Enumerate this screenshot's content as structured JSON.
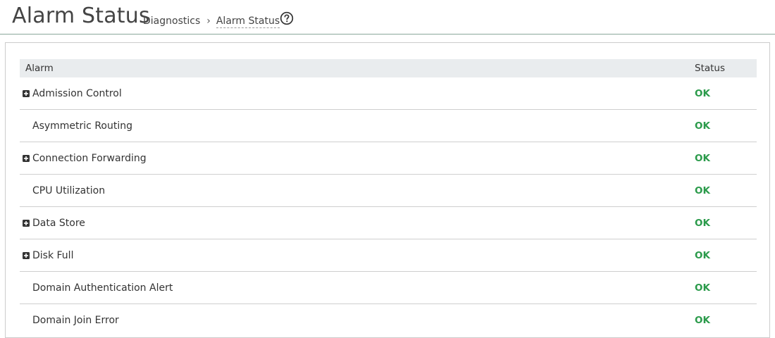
{
  "header": {
    "title": "Alarm Status",
    "breadcrumb": {
      "parent": "Diagnostics",
      "separator": "›",
      "current": "Alarm Status"
    },
    "help_icon": "question-circle-icon"
  },
  "table": {
    "columns": {
      "alarm": "Alarm",
      "status": "Status"
    },
    "rows": [
      {
        "name": "Admission Control",
        "status": "OK",
        "expandable": true
      },
      {
        "name": "Asymmetric Routing",
        "status": "OK",
        "expandable": false
      },
      {
        "name": "Connection Forwarding",
        "status": "OK",
        "expandable": true
      },
      {
        "name": "CPU Utilization",
        "status": "OK",
        "expandable": false
      },
      {
        "name": "Data Store",
        "status": "OK",
        "expandable": true
      },
      {
        "name": "Disk Full",
        "status": "OK",
        "expandable": true
      },
      {
        "name": "Domain Authentication Alert",
        "status": "OK",
        "expandable": false
      },
      {
        "name": "Domain Join Error",
        "status": "OK",
        "expandable": false
      }
    ]
  },
  "colors": {
    "status_ok": "#2a9a4a",
    "header_rule": "#8aa79a",
    "table_header_bg": "#e9ecee"
  }
}
